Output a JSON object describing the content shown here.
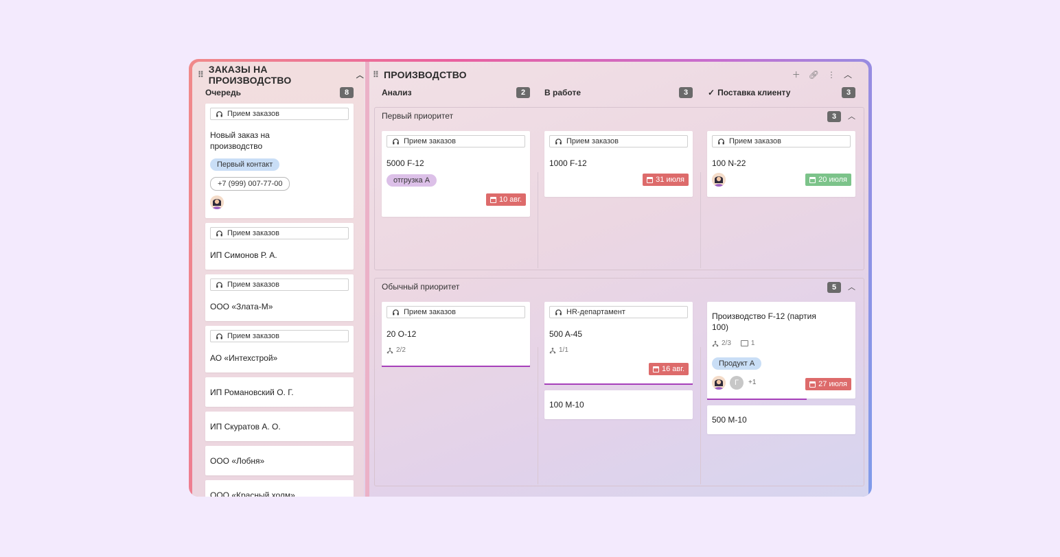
{
  "left_section": {
    "title": "ЗАКАЗЫ НА ПРОИЗВОДСТВО",
    "column": {
      "name": "Очередь",
      "count": "8"
    },
    "cards": [
      {
        "source": "Прием заказов",
        "title": "Новый заказ на производство",
        "tag": "Первый контакт",
        "phone": "+7 (999) 007-77-00"
      },
      {
        "source": "Прием заказов",
        "title": "ИП Симонов Р. А."
      },
      {
        "source": "Прием заказов",
        "title": "ООО «Злата-М»"
      },
      {
        "source": "Прием заказов",
        "title": "АО «Интехстрой»"
      },
      {
        "title": "ИП Романовский О. Г."
      },
      {
        "title": "ИП Скуратов А. О."
      },
      {
        "title": "ООО «Лобня»"
      },
      {
        "title": "ООО «Красный холм»"
      }
    ]
  },
  "production": {
    "title": "ПРОИЗВОДСТВО",
    "actions": [
      "add-icon",
      "link-icon",
      "more-icon",
      "collapse-icon"
    ],
    "columns": [
      {
        "name": "Анализ",
        "count": "2"
      },
      {
        "name": "В работе",
        "count": "3"
      },
      {
        "name": "Поставка клиенту",
        "count": "3",
        "done_mark": "✓"
      }
    ],
    "groups": [
      {
        "name": "Первый приоритет",
        "count": "3",
        "cards": [
          {
            "source": "Прием заказов",
            "title": "5000 F-12",
            "tag": "отгрузка А",
            "date": "10 авг."
          },
          {
            "source": "Прием заказов",
            "title": "1000 F-12",
            "date": "31 июля"
          },
          {
            "source": "Прием заказов",
            "title": "100 N-22",
            "date": "20 июля"
          }
        ]
      },
      {
        "name": "Обычный приоритет",
        "count": "5",
        "cards": [
          {
            "source": "Прием заказов",
            "title": "20 O-12",
            "subtasks": "2/2",
            "progress": 1.0
          },
          {
            "source": "HR-департамент",
            "title": "500 A-45",
            "subtasks": "1/1",
            "date": "16 авг.",
            "progress": 1.0
          },
          {
            "title": "100 M-10"
          },
          {
            "title": "Производство F-12 (партия 100)",
            "subtasks": "2/3",
            "comments": "1",
            "tag": "Продукт А",
            "extra_assignee_initial": "Г",
            "extra_count": "+1",
            "date": "27 июля",
            "progress": 0.67
          },
          {
            "title": "500 M-10"
          }
        ]
      }
    ]
  },
  "colors": {
    "accent_purple": "#a63fba",
    "date_red": "#dd6b6b",
    "date_green": "#7cc38a",
    "tag_blue": "#c9def6"
  }
}
